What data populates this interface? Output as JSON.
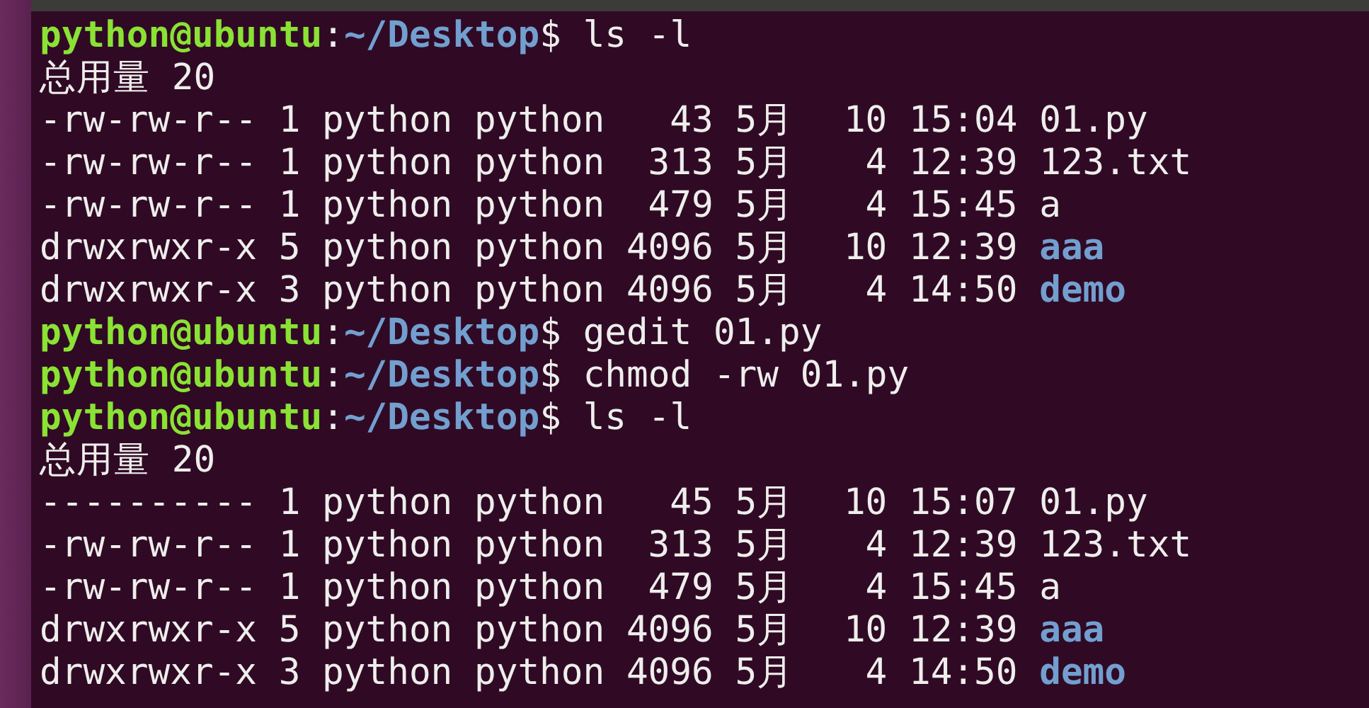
{
  "terminal": {
    "lines": [
      {
        "kind": "prompt",
        "user": "python@ubuntu",
        "separator": ":",
        "path": "~/Desktop",
        "symbol": "$",
        "command": "ls -l"
      },
      {
        "kind": "text",
        "text": "总用量 20"
      },
      {
        "kind": "entry",
        "permissions": "-rw-rw-r--",
        "links": "1",
        "owner": "python",
        "group": "python",
        "size": "43",
        "month": "5月",
        "day": "10",
        "time": "15:04",
        "name": "01.py",
        "directory": false
      },
      {
        "kind": "entry",
        "permissions": "-rw-rw-r--",
        "links": "1",
        "owner": "python",
        "group": "python",
        "size": "313",
        "month": "5月",
        "day": "4",
        "time": "12:39",
        "name": "123.txt",
        "directory": false
      },
      {
        "kind": "entry",
        "permissions": "-rw-rw-r--",
        "links": "1",
        "owner": "python",
        "group": "python",
        "size": "479",
        "month": "5月",
        "day": "4",
        "time": "15:45",
        "name": "a",
        "directory": false
      },
      {
        "kind": "entry",
        "permissions": "drwxrwxr-x",
        "links": "5",
        "owner": "python",
        "group": "python",
        "size": "4096",
        "month": "5月",
        "day": "10",
        "time": "12:39",
        "name": "aaa",
        "directory": true
      },
      {
        "kind": "entry",
        "permissions": "drwxrwxr-x",
        "links": "3",
        "owner": "python",
        "group": "python",
        "size": "4096",
        "month": "5月",
        "day": "4",
        "time": "14:50",
        "name": "demo",
        "directory": true
      },
      {
        "kind": "prompt",
        "user": "python@ubuntu",
        "separator": ":",
        "path": "~/Desktop",
        "symbol": "$",
        "command": "gedit 01.py"
      },
      {
        "kind": "prompt",
        "user": "python@ubuntu",
        "separator": ":",
        "path": "~/Desktop",
        "symbol": "$",
        "command": "chmod -rw 01.py"
      },
      {
        "kind": "prompt",
        "user": "python@ubuntu",
        "separator": ":",
        "path": "~/Desktop",
        "symbol": "$",
        "command": "ls -l"
      },
      {
        "kind": "text",
        "text": "总用量 20"
      },
      {
        "kind": "entry",
        "permissions": "----------",
        "links": "1",
        "owner": "python",
        "group": "python",
        "size": "45",
        "month": "5月",
        "day": "10",
        "time": "15:07",
        "name": "01.py",
        "directory": false
      },
      {
        "kind": "entry",
        "permissions": "-rw-rw-r--",
        "links": "1",
        "owner": "python",
        "group": "python",
        "size": "313",
        "month": "5月",
        "day": "4",
        "time": "12:39",
        "name": "123.txt",
        "directory": false
      },
      {
        "kind": "entry",
        "permissions": "-rw-rw-r--",
        "links": "1",
        "owner": "python",
        "group": "python",
        "size": "479",
        "month": "5月",
        "day": "4",
        "time": "15:45",
        "name": "a",
        "directory": false
      },
      {
        "kind": "entry",
        "permissions": "drwxrwxr-x",
        "links": "5",
        "owner": "python",
        "group": "python",
        "size": "4096",
        "month": "5月",
        "day": "10",
        "time": "12:39",
        "name": "aaa",
        "directory": true
      },
      {
        "kind": "entry",
        "permissions": "drwxrwxr-x",
        "links": "3",
        "owner": "python",
        "group": "python",
        "size": "4096",
        "month": "5月",
        "day": "4",
        "time": "14:50",
        "name": "demo",
        "directory": true
      }
    ]
  }
}
